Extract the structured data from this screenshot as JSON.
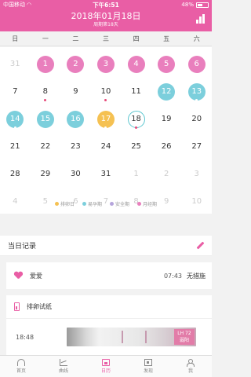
{
  "status_bar": {
    "carrier": "中国移动",
    "time": "下午6:51",
    "battery": "48%"
  },
  "header": {
    "date": "2018年01月18日",
    "cycle_info": "周期第18天",
    "stats_icon": "bar-chart-icon"
  },
  "weekdays": [
    "日",
    "一",
    "二",
    "三",
    "四",
    "五",
    "六"
  ],
  "calendar_days": [
    {
      "label": "31",
      "state": "faded",
      "dot": false
    },
    {
      "label": "1",
      "state": "period",
      "dot": false
    },
    {
      "label": "2",
      "state": "period",
      "dot": false
    },
    {
      "label": "3",
      "state": "period",
      "dot": false
    },
    {
      "label": "4",
      "state": "period",
      "dot": false
    },
    {
      "label": "5",
      "state": "period",
      "dot": false
    },
    {
      "label": "6",
      "state": "period",
      "dot": false
    },
    {
      "label": "7",
      "state": "normal",
      "dot": false
    },
    {
      "label": "8",
      "state": "normal",
      "dot": true
    },
    {
      "label": "9",
      "state": "normal",
      "dot": false
    },
    {
      "label": "10",
      "state": "normal",
      "dot": true
    },
    {
      "label": "11",
      "state": "normal",
      "dot": false
    },
    {
      "label": "12",
      "state": "safe",
      "dot": false
    },
    {
      "label": "13",
      "state": "safe",
      "dot": true
    },
    {
      "label": "14",
      "state": "safe",
      "dot": true
    },
    {
      "label": "15",
      "state": "safe",
      "dot": false
    },
    {
      "label": "16",
      "state": "safe",
      "dot": false
    },
    {
      "label": "17",
      "state": "ovul",
      "dot": true
    },
    {
      "label": "18",
      "state": "today",
      "dot": true
    },
    {
      "label": "19",
      "state": "normal",
      "dot": false
    },
    {
      "label": "20",
      "state": "normal",
      "dot": false
    },
    {
      "label": "21",
      "state": "normal",
      "dot": false
    },
    {
      "label": "22",
      "state": "normal",
      "dot": false
    },
    {
      "label": "23",
      "state": "normal",
      "dot": false
    },
    {
      "label": "24",
      "state": "normal",
      "dot": false
    },
    {
      "label": "25",
      "state": "normal",
      "dot": false
    },
    {
      "label": "26",
      "state": "normal",
      "dot": false
    },
    {
      "label": "27",
      "state": "normal",
      "dot": false
    },
    {
      "label": "28",
      "state": "normal",
      "dot": false
    },
    {
      "label": "29",
      "state": "normal",
      "dot": false
    },
    {
      "label": "30",
      "state": "normal",
      "dot": false
    },
    {
      "label": "31",
      "state": "normal",
      "dot": false
    },
    {
      "label": "1",
      "state": "faded",
      "dot": false
    },
    {
      "label": "2",
      "state": "faded",
      "dot": false
    },
    {
      "label": "3",
      "state": "faded",
      "dot": false
    },
    {
      "label": "4",
      "state": "faded",
      "dot": false
    },
    {
      "label": "5",
      "state": "faded",
      "dot": false
    },
    {
      "label": "6",
      "state": "faded",
      "dot": false
    },
    {
      "label": "7",
      "state": "faded",
      "dot": false
    },
    {
      "label": "8",
      "state": "faded",
      "dot": false
    },
    {
      "label": "9",
      "state": "faded",
      "dot": false
    },
    {
      "label": "10",
      "state": "faded",
      "dot": false
    }
  ],
  "legend": [
    {
      "label": "排卵日",
      "color": "#f5c152"
    },
    {
      "label": "易孕期",
      "color": "#7ccfdc"
    },
    {
      "label": "安全期",
      "color": "#b6a5dc"
    },
    {
      "label": "月经期",
      "color": "#e97fbd"
    }
  ],
  "records": {
    "title": "当日记录",
    "edit_icon": "pencil-icon",
    "love": {
      "label": "爱爱",
      "time": "07:43",
      "status": "无措施"
    },
    "ovulation_test": {
      "label": "排卵试纸",
      "time": "18:48",
      "result_line1": "LH 72",
      "result_line2": "弱阳"
    }
  },
  "tabs": [
    {
      "label": "首页",
      "icon": "home-icon"
    },
    {
      "label": "曲线",
      "icon": "curve-icon"
    },
    {
      "label": "日历",
      "icon": "calendar-icon",
      "active": true
    },
    {
      "label": "发现",
      "icon": "discover-icon"
    },
    {
      "label": "我",
      "icon": "profile-icon"
    }
  ],
  "colors": {
    "brand": "#e95ea5",
    "period": "#e97fbd",
    "safe": "#7ccfdc",
    "ovulation": "#f5c152"
  }
}
